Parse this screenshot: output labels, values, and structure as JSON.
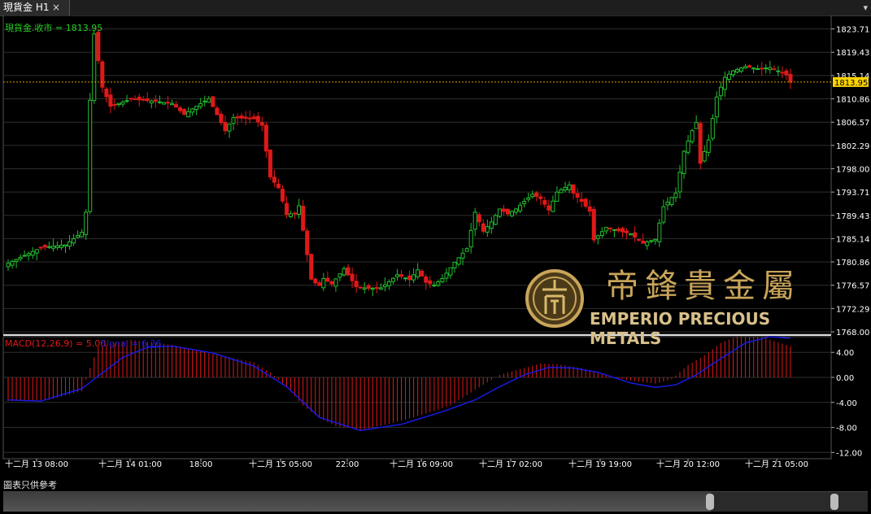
{
  "tab": {
    "title": "現貨金 H1",
    "close": "×",
    "menu": "▾"
  },
  "price_label": "現貨金.收市 = 1813.95",
  "macd_label": "MACD(12,26,9) = 5.00",
  "signal_label": "Signal = 6.26",
  "footer": "圖表只供參考",
  "logo": {
    "cn": "帝鋒貴金屬",
    "en": "EMPERIO PRECIOUS METALS"
  },
  "colors": {
    "up": "#21c02e",
    "down": "#e01818",
    "macd_bar": "#e01818",
    "signal": "#1a1ae0",
    "grid": "#2e2e2e",
    "axis_text": "#ffffff",
    "current_price_bg": "#ffd400",
    "current_line": "#e0a000"
  },
  "chart_data": [
    {
      "type": "candlestick",
      "yaxis_ticks": [
        "1823.71",
        "1819.43",
        "1815.14",
        "1810.86",
        "1806.57",
        "1802.29",
        "1798.00",
        "1793.71",
        "1789.43",
        "1785.14",
        "1780.86",
        "1776.57",
        "1772.29",
        "1768.00"
      ],
      "ylim": [
        1768.0,
        1825.0
      ],
      "current_price": "1813.95",
      "x_ticks": [
        "十二月 13 08:00",
        "十二月 14 01:00",
        "18:00",
        "十二月 15 05:00",
        "22:00",
        "十二月 16 09:00",
        "十二月 17 02:00",
        "十二月 19 19:00",
        "十二月 20 12:00",
        "十二月 21 05:00"
      ],
      "keyframes": [
        [
          0,
          1780.6
        ],
        [
          8,
          1783.5
        ],
        [
          14,
          1784.0
        ],
        [
          18,
          1786.3
        ],
        [
          19,
          1790
        ],
        [
          20,
          1810.6
        ],
        [
          21,
          1822.8
        ],
        [
          23,
          1813.0
        ],
        [
          25,
          1809.5
        ],
        [
          30,
          1810.8
        ],
        [
          36,
          1810.4
        ],
        [
          40,
          1810.0
        ],
        [
          43,
          1808.0
        ],
        [
          46,
          1809.5
        ],
        [
          49,
          1810.9
        ],
        [
          53,
          1805.0
        ],
        [
          55,
          1807.4
        ],
        [
          60,
          1807.2
        ],
        [
          62,
          1806.0
        ],
        [
          64,
          1796.5
        ],
        [
          66,
          1794.5
        ],
        [
          68,
          1789.6
        ],
        [
          70,
          1789.8
        ],
        [
          71,
          1791.2
        ],
        [
          72,
          1786.7
        ],
        [
          74,
          1777.7
        ],
        [
          75,
          1777.0
        ],
        [
          76,
          1776.5
        ],
        [
          77,
          1777.8
        ],
        [
          79,
          1776.8
        ],
        [
          82,
          1779.6
        ],
        [
          85,
          1776.3
        ],
        [
          88,
          1776.0
        ],
        [
          91,
          1776.1
        ],
        [
          93,
          1777.2
        ],
        [
          95,
          1778.5
        ],
        [
          98,
          1777.6
        ],
        [
          100,
          1779.4
        ],
        [
          102,
          1777.1
        ],
        [
          104,
          1776.6
        ],
        [
          106,
          1777.8
        ],
        [
          109,
          1780.8
        ],
        [
          112,
          1783.3
        ],
        [
          114,
          1790.0
        ],
        [
          116,
          1786.5
        ],
        [
          118,
          1788.2
        ],
        [
          120,
          1790.6
        ],
        [
          122,
          1789.7
        ],
        [
          124,
          1790.6
        ],
        [
          126,
          1792.0
        ],
        [
          128,
          1793.3
        ],
        [
          130,
          1792.5
        ],
        [
          132,
          1790.4
        ],
        [
          134,
          1793.7
        ],
        [
          137,
          1795.0
        ],
        [
          138,
          1793.5
        ],
        [
          140,
          1792.0
        ],
        [
          142,
          1790.2
        ],
        [
          143,
          1784.9
        ],
        [
          146,
          1787.2
        ],
        [
          149,
          1786.6
        ],
        [
          152,
          1786.0
        ],
        [
          155,
          1784.3
        ],
        [
          158,
          1785.0
        ],
        [
          160,
          1791.0
        ],
        [
          162,
          1792.7
        ],
        [
          163,
          1793.5
        ],
        [
          165,
          1801.2
        ],
        [
          167,
          1805.0
        ],
        [
          168,
          1806.5
        ],
        [
          169,
          1799.0
        ],
        [
          171,
          1803.3
        ],
        [
          173,
          1811.2
        ],
        [
          175,
          1814.8
        ],
        [
          177,
          1816.0
        ],
        [
          180,
          1816.8
        ],
        [
          183,
          1816.4
        ],
        [
          186,
          1816.6
        ],
        [
          188,
          1816.0
        ],
        [
          190,
          1815.3
        ],
        [
          191,
          1813.95
        ]
      ],
      "macd_keyframes": [
        [
          0,
          -3.8
        ],
        [
          10,
          -3.6
        ],
        [
          18,
          -2.2
        ],
        [
          20,
          1.5
        ],
        [
          22,
          4.9
        ],
        [
          30,
          6.0
        ],
        [
          40,
          5.2
        ],
        [
          50,
          3.8
        ],
        [
          60,
          2.4
        ],
        [
          64,
          0.8
        ],
        [
          68,
          -1.5
        ],
        [
          72,
          -4.5
        ],
        [
          76,
          -6.5
        ],
        [
          80,
          -7.8
        ],
        [
          86,
          -8.4
        ],
        [
          92,
          -7.6
        ],
        [
          100,
          -6.2
        ],
        [
          108,
          -4.5
        ],
        [
          114,
          -2.0
        ],
        [
          120,
          0.4
        ],
        [
          126,
          1.5
        ],
        [
          130,
          2.2
        ],
        [
          134,
          2.1
        ],
        [
          140,
          1.5
        ],
        [
          146,
          0.3
        ],
        [
          152,
          -0.5
        ],
        [
          158,
          -1.0
        ],
        [
          162,
          -0.3
        ],
        [
          166,
          2.0
        ],
        [
          170,
          3.5
        ],
        [
          174,
          5.5
        ],
        [
          178,
          6.6
        ],
        [
          184,
          6.4
        ],
        [
          191,
          5.0
        ]
      ],
      "signal_keyframes": [
        [
          0,
          -3.6
        ],
        [
          8,
          -3.8
        ],
        [
          18,
          -1.8
        ],
        [
          22,
          0.2
        ],
        [
          28,
          3.2
        ],
        [
          34,
          4.8
        ],
        [
          40,
          5.0
        ],
        [
          50,
          3.9
        ],
        [
          60,
          1.8
        ],
        [
          68,
          -1.5
        ],
        [
          76,
          -6.4
        ],
        [
          86,
          -8.5
        ],
        [
          96,
          -7.5
        ],
        [
          106,
          -5.5
        ],
        [
          114,
          -3.6
        ],
        [
          120,
          -1.5
        ],
        [
          126,
          0.4
        ],
        [
          132,
          1.6
        ],
        [
          138,
          1.5
        ],
        [
          144,
          0.8
        ],
        [
          152,
          -0.9
        ],
        [
          158,
          -1.6
        ],
        [
          163,
          -1.2
        ],
        [
          168,
          0.4
        ],
        [
          174,
          3.0
        ],
        [
          180,
          5.5
        ],
        [
          186,
          6.5
        ],
        [
          191,
          6.26
        ]
      ],
      "macd_ylim": [
        -13.0,
        6.5
      ],
      "macd_ticks": [
        "4.00",
        "0.00",
        "-4.00",
        "-8.00",
        "-12.00"
      ]
    }
  ]
}
